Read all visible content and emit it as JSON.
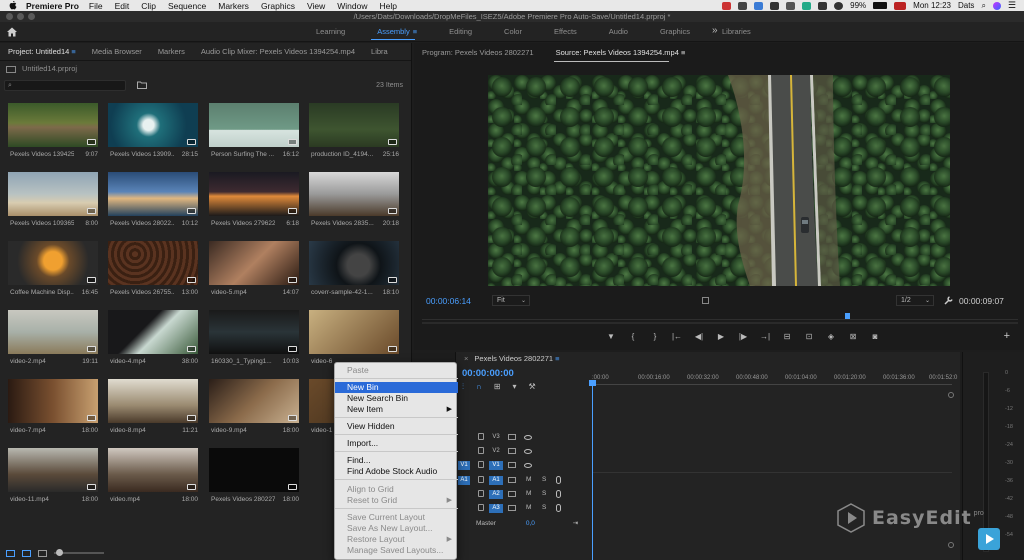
{
  "menubar": {
    "app_name": "Premiere Pro",
    "items": [
      "File",
      "Edit",
      "Clip",
      "Sequence",
      "Markers",
      "Graphics",
      "View",
      "Window",
      "Help"
    ],
    "battery": "99%",
    "time": "Mon 12:23",
    "user": "Dats"
  },
  "window": {
    "title": "/Users/Dats/Downloads/DropMeFiles_ISEZ5/Adobe Premiere Pro Auto-Save/Untitled14.prproj *"
  },
  "workspaces": {
    "tabs": [
      {
        "label": "Learning"
      },
      {
        "label": "Assembly",
        "active": true
      },
      {
        "label": "Editing"
      },
      {
        "label": "Color"
      },
      {
        "label": "Effects"
      },
      {
        "label": "Audio"
      },
      {
        "label": "Graphics"
      },
      {
        "label": "Libraries"
      }
    ],
    "more": "»"
  },
  "project_panel": {
    "tabs": [
      "Project: Untitled14",
      "Media Browser",
      "Markers",
      "Audio Clip Mixer: Pexels Videos 1394254.mp4",
      "Libra"
    ],
    "project_file": "Untitled14.prproj",
    "search_placeholder": "",
    "item_count": "23 Items",
    "clips": [
      {
        "name": "Pexels Videos 139425...",
        "duration": "9:07"
      },
      {
        "name": "Pexels Videos 13909...",
        "duration": "28:15"
      },
      {
        "name": "Person Surfing The ...",
        "duration": "16:12"
      },
      {
        "name": "production ID_4194...",
        "duration": "25:16"
      },
      {
        "name": "Pexels Videos 109365...",
        "duration": "8:00"
      },
      {
        "name": "Pexels Videos 28022...",
        "duration": "10:12"
      },
      {
        "name": "Pexels Videos 279622...",
        "duration": "6:18"
      },
      {
        "name": "Pexels Videos 2835...",
        "duration": "20:18"
      },
      {
        "name": "Coffee Machine Disp...",
        "duration": "16:45"
      },
      {
        "name": "Pexels Videos 26755...",
        "duration": "13:00"
      },
      {
        "name": "video-5.mp4",
        "duration": "14:07"
      },
      {
        "name": "coverr-sample-42-1...",
        "duration": "18:10"
      },
      {
        "name": "video-2.mp4",
        "duration": "19:11"
      },
      {
        "name": "video-4.mp4",
        "duration": "38:00"
      },
      {
        "name": "160330_1_Typing1...",
        "duration": "10:03"
      },
      {
        "name": "video-6",
        "duration": ""
      },
      {
        "name": "video-7.mp4",
        "duration": "18:00"
      },
      {
        "name": "video-8.mp4",
        "duration": "11:21"
      },
      {
        "name": "video-9.mp4",
        "duration": "18:00"
      },
      {
        "name": "video-1",
        "duration": ""
      },
      {
        "name": "video-11.mp4",
        "duration": "18:00"
      },
      {
        "name": "video.mp4",
        "duration": "18:00"
      },
      {
        "name": "Pexels Videos 2802271",
        "duration": "18:00"
      }
    ]
  },
  "monitor": {
    "tabs": [
      "Program: Pexels Videos 2802271",
      "Source: Pexels Videos 1394254.mp4"
    ],
    "current_tc": "00:00:06:14",
    "zoom": "Fit",
    "resolution": "1/2",
    "duration_tc": "00:00:09:07",
    "playhead_fraction": 0.71,
    "controls": [
      "▼",
      "{",
      "}",
      "|←",
      "◀|",
      "▶",
      "|▶",
      "→|",
      "⊟",
      "⊡",
      "◈",
      "⊠",
      "◙"
    ],
    "add_button": "+"
  },
  "timeline": {
    "sequence": "Pexels Videos 2802271",
    "timecode": "00:00:00:00",
    "ruler": [
      ":00:00",
      "00:00:16:00",
      "00:00:32:00",
      "00:00:48:00",
      "00:01:04:00",
      "00:01:20:00",
      "00:01:36:00",
      "00:01:52:0"
    ],
    "video_tracks": [
      "V3",
      "V2",
      "V1"
    ],
    "audio_tracks": [
      "A1",
      "A2",
      "A3"
    ],
    "master_label": "Master",
    "master_value": "0,0"
  },
  "audio_meter": {
    "labels": [
      "0",
      "-6",
      "-12",
      "-18",
      "-24",
      "-30",
      "-36",
      "-42",
      "-48",
      "-54"
    ]
  },
  "context_menu": {
    "items": [
      {
        "label": "Paste",
        "disabled": true
      },
      {
        "label": "New Bin",
        "highlighted": true
      },
      {
        "label": "New Search Bin"
      },
      {
        "label": "New Item",
        "submenu": true
      },
      {
        "label": "View Hidden"
      },
      {
        "label": "Import..."
      },
      {
        "label": "Find..."
      },
      {
        "label": "Find Adobe Stock Audio"
      },
      {
        "label": "Align to Grid",
        "disabled": true
      },
      {
        "label": "Reset to Grid",
        "disabled": true,
        "submenu": true
      },
      {
        "label": "Save Current Layout",
        "disabled": true
      },
      {
        "label": "Save As New Layout...",
        "disabled": true
      },
      {
        "label": "Restore Layout",
        "disabled": true,
        "submenu": true
      },
      {
        "label": "Manage Saved Layouts...",
        "disabled": true
      }
    ]
  },
  "watermark": {
    "brand": "EasyEdit",
    "suffix": "pro"
  },
  "colors": {
    "accent": "#4a9fff",
    "menu_highlight": "#2a6ad8"
  }
}
